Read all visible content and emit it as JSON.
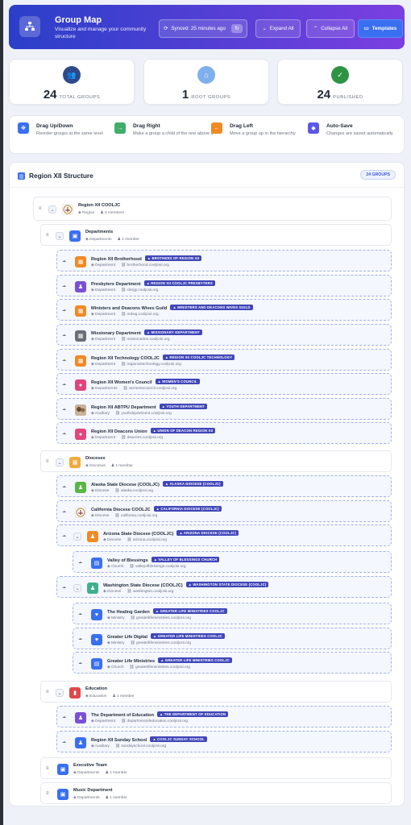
{
  "header": {
    "title": "Group Map",
    "subtitle": "Visualize and manage your community structure",
    "synced": "Synced: 25 minutes ago",
    "expand_label": "Expand All",
    "collapse_label": "Collapse All",
    "templates_label": "Templates"
  },
  "stats": [
    {
      "value": "24",
      "label": "TOTAL GROUPS",
      "color": "#2f4a8a"
    },
    {
      "value": "1",
      "label": "ROOT GROUPS",
      "color": "#7fb0ec"
    },
    {
      "value": "24",
      "label": "PUBLISHED",
      "color": "#2e9444"
    }
  ],
  "tips": [
    {
      "title": "Drag Up/Down",
      "desc": "Reorder groups at the same level",
      "color": "#3a6ff2"
    },
    {
      "title": "Drag Right",
      "desc": "Make a group a child of the one above it",
      "color": "#3fae6a"
    },
    {
      "title": "Drag Left",
      "desc": "Move a group up in the hierarchy",
      "color": "#f08a24"
    },
    {
      "title": "Auto-Save",
      "desc": "Changes are saved automatically",
      "color": "#5b57e6"
    }
  ],
  "panel": {
    "title": "Region XII Structure",
    "badge": "24 GROUPS"
  },
  "tree": [
    {
      "name": "Region XII COOLJC",
      "type": "Region",
      "members": "3 members",
      "tag": "",
      "url": "",
      "icon": "logo",
      "color": "#ffffff"
    },
    {
      "name": "Departments",
      "type": "Departments",
      "members": "1 member",
      "tag": "",
      "url": "",
      "icon": "folder",
      "color": "#3a6ff2"
    },
    {
      "name": "Region XII Brotherhood",
      "type": "Department",
      "tag": "BROTHERS OF REGION XII",
      "url": "brotherhood.cooljcsii.org",
      "icon": "building",
      "color": "#f08a24"
    },
    {
      "name": "Presbyters Department",
      "type": "Department",
      "tag": "REGION XII COOLJC PRESBYTERS",
      "url": "clergy.cooljcsii.org",
      "icon": "people",
      "color": "#7b4fd6"
    },
    {
      "name": "Ministers and Deacons Wives Guild",
      "type": "Department",
      "tag": "MINISTERS AND DEACONS WIVES GUILD",
      "url": "mdwg.cooljcsii.org",
      "icon": "building",
      "color": "#f08a24"
    },
    {
      "name": "Missionary Department",
      "type": "Department",
      "tag": "MISSIONARY DEPARTMENT",
      "url": "missionaries.cooljcsii.org",
      "icon": "building",
      "color": "#6b6f78"
    },
    {
      "name": "Region XII Technology COOLJC",
      "type": "Department",
      "tag": "REGION XII COOLJC TECHNOLOGY",
      "url": "regionxiitechnology.cooljcsii.org",
      "icon": "building",
      "color": "#f08a24"
    },
    {
      "name": "Region XII Women's Council",
      "type": "Departments",
      "tag": "WOMEN'S COUNCIL",
      "url": "womenscouncil.cooljcsii.org",
      "icon": "pin",
      "color": "#e0457b"
    },
    {
      "name": "Region XII ABTPU Department",
      "type": "Auxiliary",
      "tag": "YOUTH DEPARTMENT",
      "url": "youthdepartment.cooljcsii.org",
      "icon": "photo",
      "color": "#8a6a4d"
    },
    {
      "name": "Region XII Deacons Union",
      "type": "Department",
      "tag": "UNION OF DEACON REGION XII",
      "url": "deacons.cooljcsii.org",
      "icon": "pin",
      "color": "#e0457b"
    },
    {
      "name": "Dioceses",
      "type": "Dioceses",
      "members": "1 member",
      "tag": "",
      "url": "",
      "icon": "building",
      "color": "#f2a93b"
    },
    {
      "name": "Alaska State Diocese (COOLJC)",
      "type": "Diocese",
      "tag": "ALASKA DIOCESE (COOLJC)",
      "url": "alaska.cooljcsii.org",
      "icon": "people",
      "color": "#5bb548"
    },
    {
      "name": "California Diocese COOLJC",
      "type": "Diocese",
      "tag": "CALIFORNIA DIOCESE (COOLJC)",
      "url": "california.cooljcsii.org",
      "icon": "logo",
      "color": "#ffffff"
    },
    {
      "name": "Arizona State Diocese (COOLJC)",
      "type": "Diocese",
      "tag": "ARIZONA DIOCESE (COOLJC)",
      "url": "arizona.cooljcsii.org",
      "icon": "people",
      "color": "#f08a24"
    },
    {
      "name": "Valley of Blessings",
      "type": "Church",
      "tag": "VALLEY OF BLESSINGS CHURCH",
      "url": "valleyofblessings.cooljcsii.org",
      "icon": "doc",
      "color": "#3a6ff2"
    },
    {
      "name": "Washington State Diocese (COOLJC)",
      "type": "Diocese",
      "tag": "WASHINGTON STATE DIOCESE (COOLJC)",
      "url": "washington.cooljcsii.org",
      "icon": "people",
      "color": "#3fb08f"
    },
    {
      "name": "The Healing Garden",
      "type": "Ministry",
      "tag": "GREATER LIFE MINISTRIES COOLJC",
      "url": "greaterlifeministries.cooljcsii.org",
      "icon": "heart",
      "color": "#3a6ff2"
    },
    {
      "name": "Greater Life Digital",
      "type": "Ministry",
      "tag": "GREATER LIFE MINISTRIES COOLJC",
      "url": "greaterlifeministries.cooljcsii.org",
      "icon": "heart",
      "color": "#3a6ff2"
    },
    {
      "name": "Greater Life Ministries",
      "type": "Church",
      "tag": "GREATER LIFE MINISTRIES COOLJC",
      "url": "greaterlifeministries.cooljcsii.org",
      "icon": "doc",
      "color": "#3a6ff2"
    },
    {
      "name": "Education",
      "type": "Education",
      "members": "1 member",
      "tag": "",
      "url": "",
      "icon": "book",
      "color": "#e04848"
    },
    {
      "name": "The Department of Education",
      "type": "Department",
      "tag": "THE DEPARTMENT OF EDUCATION",
      "url": "departmentofeducation.cooljcsii.org",
      "icon": "people",
      "color": "#7b4fd6"
    },
    {
      "name": "Region XII Sunday School",
      "type": "Auxiliary",
      "tag": "COOLJC SUNDAY SCHOOL",
      "url": "sundayschool.cooljcsii.org",
      "icon": "people",
      "color": "#3a6ff2"
    },
    {
      "name": "Executive Team",
      "type": "Departments",
      "members": "1 member",
      "tag": "",
      "url": "",
      "icon": "folder",
      "color": "#3a6ff2"
    },
    {
      "name": "Music Department",
      "type": "Departments",
      "members": "1 member",
      "tag": "",
      "url": "",
      "icon": "folder",
      "color": "#3a6ff2"
    }
  ]
}
